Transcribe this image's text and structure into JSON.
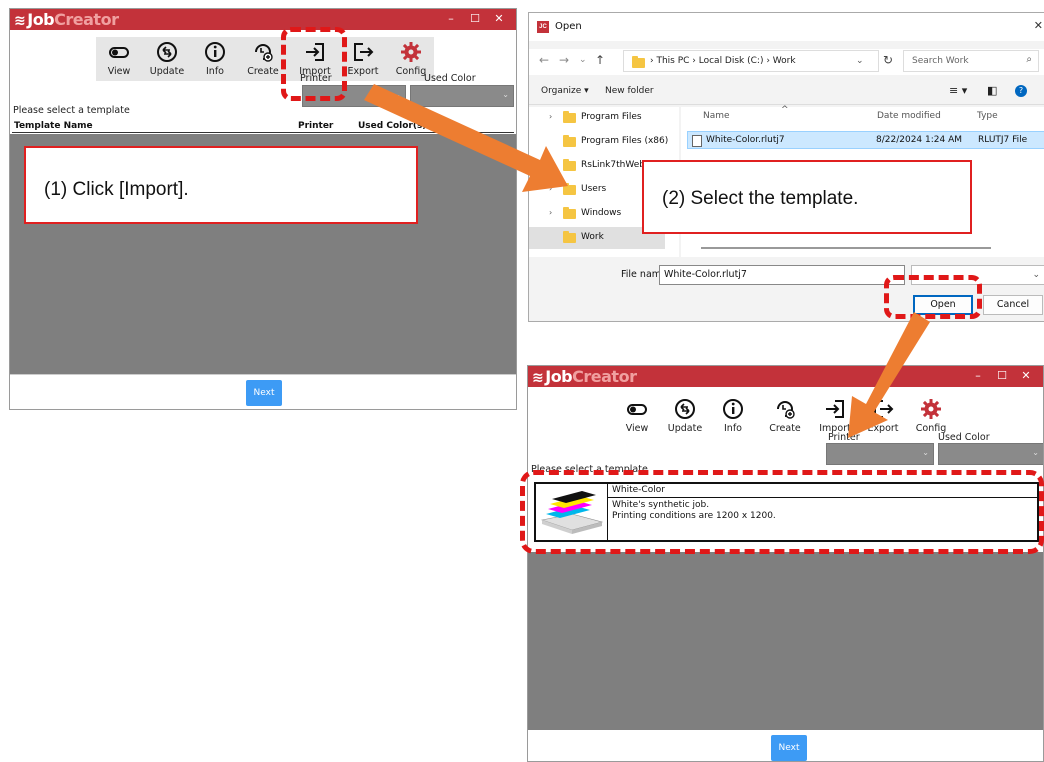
{
  "app": {
    "logo_prefix": "Job",
    "logo_suffix": "Creator",
    "win_min": "–",
    "win_max": "☐",
    "win_close": "✕"
  },
  "toolbar": {
    "view": "View",
    "update": "Update",
    "info": "Info",
    "create": "Create",
    "import": "Import",
    "export": "Export",
    "config": "Config"
  },
  "fields": {
    "printer": "Printer",
    "used_color": "Used Color"
  },
  "list": {
    "prompt": "Please select a template",
    "col_template": "Template Name",
    "col_printer": "Printer",
    "col_used_colors": "Used Color(s)",
    "next": "Next"
  },
  "template": {
    "name": "White-Color",
    "desc_line1": "White's synthetic job.",
    "desc_line2": "Printing conditions are 1200 x 1200."
  },
  "dialog": {
    "title": "Open",
    "breadcrumb": "› This PC › Local Disk (C:) › Work",
    "search_placeholder": "Search Work",
    "organize": "Organize ▾",
    "new_folder": "New folder",
    "nav_items": [
      "Program Files",
      "Program Files (x86)",
      "RsLink7thWeb",
      "Users",
      "Windows",
      "Work"
    ],
    "col_name": "Name",
    "col_date": "Date modified",
    "col_type": "Type",
    "file": {
      "name": "White-Color.rlutj7",
      "date": "8/22/2024 1:24 AM",
      "type": "RLUTJ7 File"
    },
    "file_name_label": "File name:",
    "file_name_value": "White-Color.rlutj7",
    "open": "Open",
    "cancel": "Cancel"
  },
  "annotations": {
    "step1": "(1) Click [Import].",
    "step2": "(2) Select the template."
  },
  "colors": {
    "titlebar": "#c3323a",
    "annotation_red": "#e01818",
    "arrow_orange": "#ed7d31",
    "next_blue": "#3d9bf5",
    "list_grey": "#7f7f7f"
  }
}
